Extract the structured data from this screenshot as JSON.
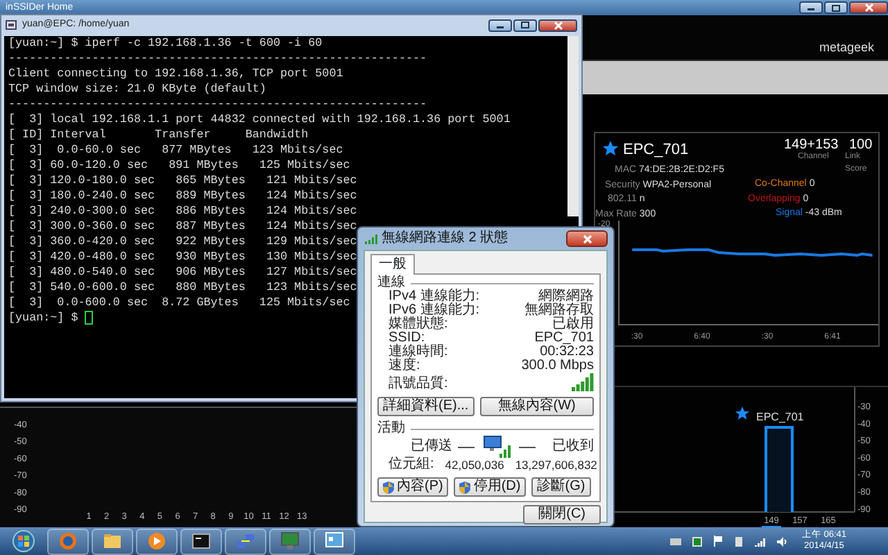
{
  "insider": {
    "title": "inSSIDer Home",
    "brand": "metageek",
    "network": {
      "name": "EPC_701",
      "channel": "149+153",
      "channel_label": "Channel",
      "link_score": "100",
      "link_score_label": "Link Score",
      "left_fields": [
        {
          "label": "MAC",
          "value": "74:DE:2B:2E:D2:F5"
        },
        {
          "label": "Security",
          "value": "WPA2-Personal"
        },
        {
          "label": "802.11",
          "value": "n"
        },
        {
          "label": "Max Rate",
          "value": "300"
        }
      ],
      "right_fields": [
        {
          "label": "Co-Channel",
          "value": "0",
          "color": "#e07a10"
        },
        {
          "label": "Overlapping",
          "value": "0",
          "color": "#c01818"
        },
        {
          "label": "Signal",
          "value": "-43 dBm",
          "color": "#1a78e0"
        }
      ],
      "graph": {
        "y_labels": [
          "-20"
        ],
        "x_labels": [
          ":30",
          "6:40",
          ":30",
          "6:41"
        ]
      }
    },
    "band_24": {
      "y_labels": [
        "-40",
        "-50",
        "-60",
        "-70",
        "-80",
        "-90"
      ],
      "x_labels": [
        "1",
        "2",
        "3",
        "4",
        "5",
        "6",
        "7",
        "8",
        "9",
        "10",
        "11",
        "12",
        "13"
      ]
    },
    "band_5": {
      "network": "EPC_701",
      "y_labels": [
        "-30",
        "-40",
        "-50",
        "-60",
        "-70",
        "-80",
        "-90"
      ],
      "x_labels": [
        "149",
        "157",
        "165"
      ]
    }
  },
  "terminal": {
    "title": "yuan@EPC: /home/yuan",
    "prompt": "[yuan:~] $ ",
    "lines": [
      "[yuan:~] $ iperf -c 192.168.1.36 -t 600 -i 60",
      "------------------------------------------------------------",
      "Client connecting to 192.168.1.36, TCP port 5001",
      "TCP window size: 21.0 KByte (default)",
      "------------------------------------------------------------",
      "[  3] local 192.168.1.1 port 44832 connected with 192.168.1.36 port 5001",
      "[ ID] Interval       Transfer     Bandwidth",
      "[  3]  0.0-60.0 sec   877 MBytes   123 Mbits/sec",
      "[  3] 60.0-120.0 sec   891 MBytes   125 Mbits/sec",
      "[  3] 120.0-180.0 sec   865 MBytes   121 Mbits/sec",
      "[  3] 180.0-240.0 sec   889 MBytes   124 Mbits/sec",
      "[  3] 240.0-300.0 sec   886 MBytes   124 Mbits/sec",
      "[  3] 300.0-360.0 sec   887 MBytes   124 Mbits/sec",
      "[  3] 360.0-420.0 sec   922 MBytes   129 Mbits/sec",
      "[  3] 420.0-480.0 sec   930 MBytes   130 Mbits/sec",
      "[  3] 480.0-540.0 sec   906 MBytes   127 Mbits/sec",
      "[  3] 540.0-600.0 sec   880 MBytes   123 Mbits/sec",
      "[  3]  0.0-600.0 sec  8.72 GBytes   125 Mbits/sec"
    ]
  },
  "dialog": {
    "title": "無線網路連線 2 狀態",
    "tabs": [
      {
        "label": "一般",
        "selected": true
      }
    ],
    "connection_heading": "連線",
    "fields": [
      {
        "label": "IPv4 連線能力:",
        "value": "網際網路"
      },
      {
        "label": "IPv6 連線能力:",
        "value": "無網路存取"
      },
      {
        "label": "媒體狀態:",
        "value": "已啟用"
      },
      {
        "label": "SSID:",
        "value": "EPC_701"
      },
      {
        "label": "連線時間:",
        "value": "00:32:23"
      },
      {
        "label": "速度:",
        "value": "300.0 Mbps"
      }
    ],
    "signal_label": "訊號品質:",
    "buttons": [
      "詳細資料(E)...",
      "無線內容(W)"
    ],
    "activity_heading": "活動",
    "sent": "已傳送",
    "received": "已收到",
    "bytes_label": "位元組:",
    "bytes_sent": "42,050,036",
    "bytes_received": "13,297,606,832",
    "action_buttons": [
      {
        "label": "內容(P)",
        "kind": "shield"
      },
      {
        "label": "停用(D)",
        "kind": "shield"
      },
      {
        "label": "診斷(G)",
        "kind": "plain"
      }
    ],
    "close": "關閉(C)"
  },
  "taskbar": {
    "time": "上午 06:41",
    "date": "2014/4/15"
  }
}
